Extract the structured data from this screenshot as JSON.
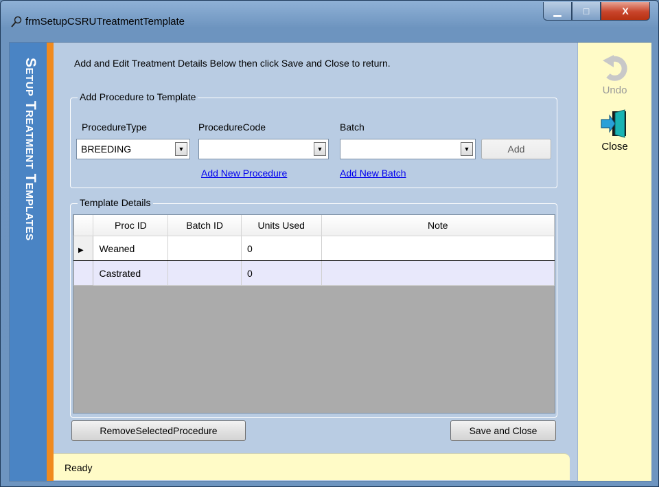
{
  "window": {
    "title": "frmSetupCSRUTreatmentTemplate",
    "buttons": {
      "minimize": "▁",
      "maximize": "□",
      "close": "X"
    }
  },
  "sidebar": {
    "title": "Setup Treatment Templates"
  },
  "instruction": "Add and Edit Treatment Details Below then click Save and Close to return.",
  "add_group": {
    "legend": "Add Procedure to Template",
    "procedure_type": {
      "label": "ProcedureType",
      "value": "BREEDING"
    },
    "procedure_code": {
      "label": "ProcedureCode",
      "value": ""
    },
    "batch": {
      "label": "Batch",
      "value": ""
    },
    "add_button": "Add",
    "add_new_procedure_link": "Add New Procedure",
    "add_new_batch_link": "Add New Batch"
  },
  "details_group": {
    "legend": "Template Details",
    "columns": [
      "Proc ID",
      "Batch ID",
      "Units Used",
      "Note"
    ],
    "rows": [
      {
        "proc_id": "Weaned",
        "batch_id": "",
        "units_used": "0",
        "note": ""
      },
      {
        "proc_id": "Castrated",
        "batch_id": "",
        "units_used": "0",
        "note": ""
      }
    ]
  },
  "buttons": {
    "remove": "RemoveSelectedProcedure",
    "save_close": "Save and Close"
  },
  "toolbar": {
    "undo_label": "Undo",
    "close_label": "Close"
  },
  "status": "Ready"
}
